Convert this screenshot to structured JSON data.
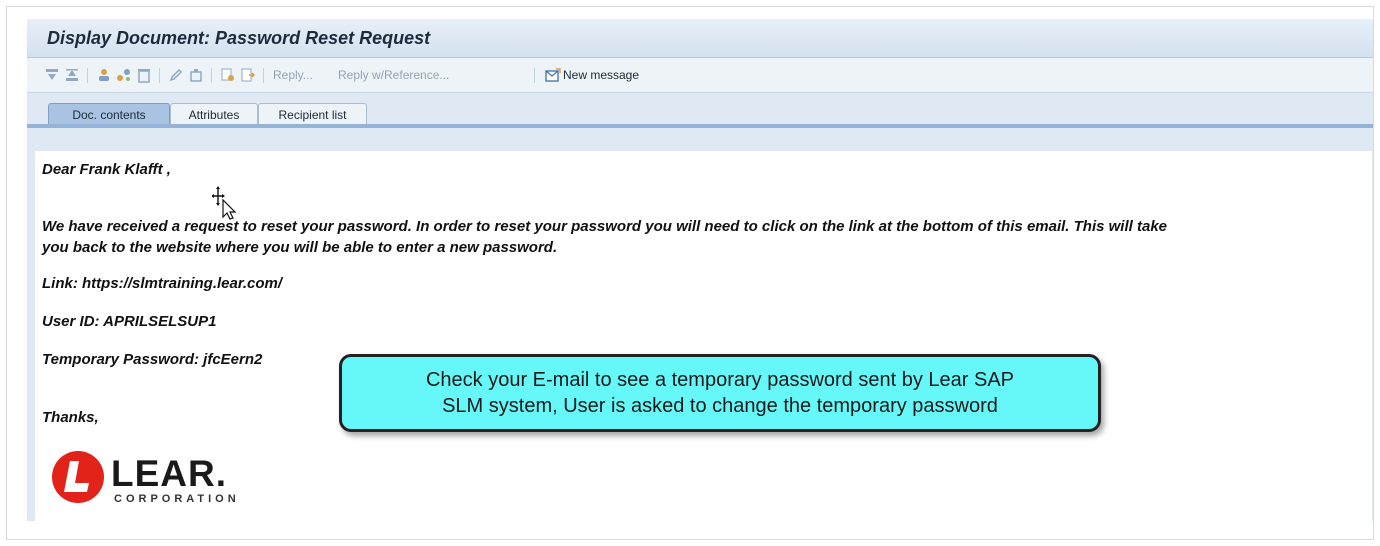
{
  "window": {
    "title": "Display Document: Password Reset Request"
  },
  "toolbar": {
    "reply_label": "Reply...",
    "reply_reference_label": "Reply w/Reference...",
    "new_message_label": "New message"
  },
  "tabs": [
    {
      "label": "Doc. contents",
      "active": true
    },
    {
      "label": "Attributes",
      "active": false
    },
    {
      "label": "Recipient list",
      "active": false
    }
  ],
  "email": {
    "greeting": "Dear Frank Klafft ,",
    "body_line1": "We have received a request to reset your password. In order to reset your password you will need to click on the link at the bottom of this email. This will take",
    "body_line2": "you back to the website where you will be able to enter a new password.",
    "link_line": "Link: https://slmtraining.lear.com/",
    "user_id_line": "User ID: APRILSELSUP1",
    "temp_password_line": "Temporary Password: jfcEern2",
    "closing": "Thanks,"
  },
  "logo": {
    "word": "LEAR.",
    "subtitle": "CORPORATION",
    "color": "#e2231a"
  },
  "callout": {
    "line1": "Check your E-mail to see a temporary password sent by Lear SAP",
    "line2": "SLM system, User is asked to change the temporary password",
    "color": "#66f8f8"
  }
}
